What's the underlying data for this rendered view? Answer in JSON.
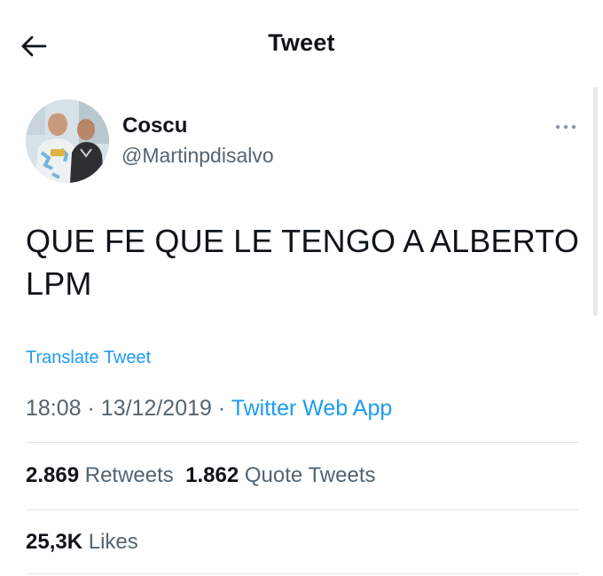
{
  "header": {
    "title": "Tweet",
    "back_icon": "arrow-left-icon"
  },
  "author": {
    "display_name": "Coscu",
    "handle": "@Martinpdisalvo",
    "avatar_icon": "profile-photo"
  },
  "more_icon": "more-horizontal-icon",
  "tweet": {
    "text": "QUE FE QUE LE TENGO A ALBERTO LPM",
    "translate_label": "Translate Tweet",
    "time": "18:08",
    "date": "13/12/2019",
    "separator": "·",
    "source": "Twitter Web App"
  },
  "stats": {
    "retweets_count": "2.869",
    "retweets_label": "Retweets",
    "quotes_count": "1.862",
    "quotes_label": "Quote Tweets",
    "likes_count": "25,3K",
    "likes_label": "Likes"
  },
  "colors": {
    "accent": "#1d9bf0",
    "text_primary": "#0f1419",
    "text_secondary": "#536471",
    "divider": "#e2e6e9"
  }
}
